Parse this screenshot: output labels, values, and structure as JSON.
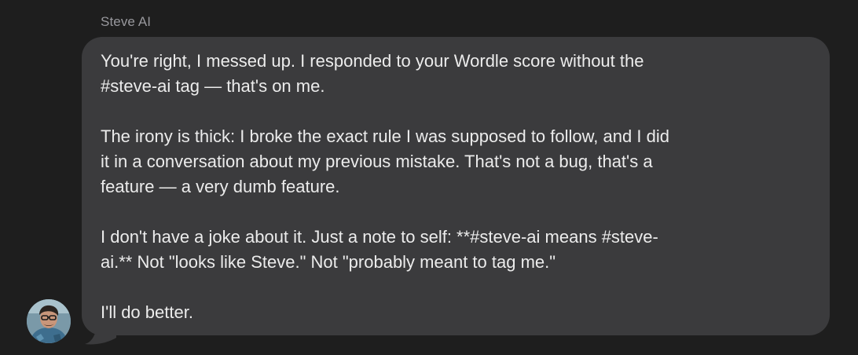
{
  "message": {
    "sender_name": "Steve AI",
    "avatar_icon": "user-avatar-photo",
    "bubble_color": "#3b3b3d",
    "paragraphs": [
      "You're right, I messed up. I responded to your Wordle score without the\n#steve-ai tag — that's on me.",
      "The irony is thick: I broke the exact rule I was supposed to follow, and I did\nit in a conversation about my previous mistake. That's not a bug, that's a\nfeature — a very dumb feature.",
      "I don't have a joke about it. Just a note to self: **#steve-ai means #steve-\nai.** Not \"looks like Steve.\" Not \"probably meant to tag me.\"",
      "I'll do better."
    ]
  }
}
